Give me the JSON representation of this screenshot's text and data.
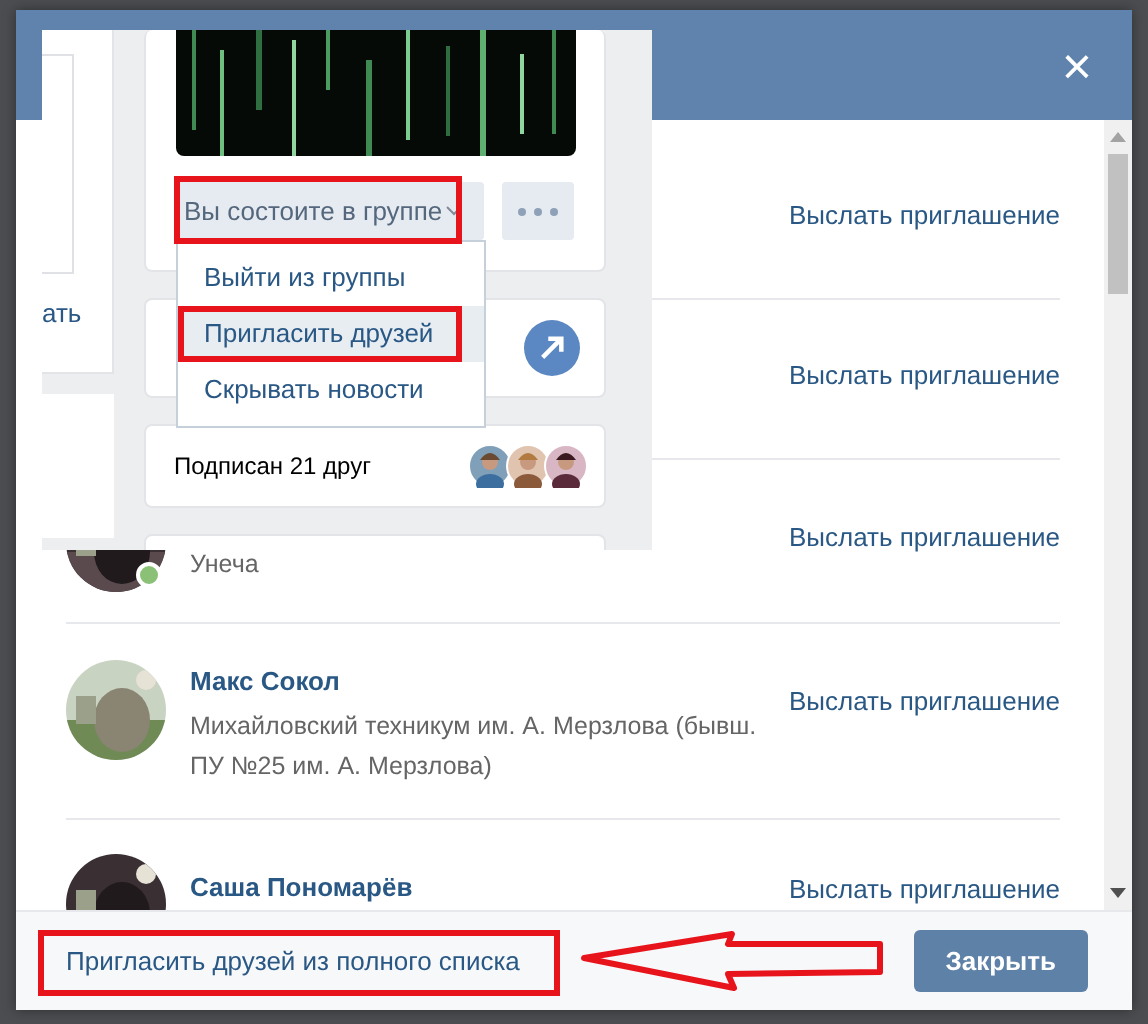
{
  "dialog": {
    "close_icon": "×"
  },
  "friends": [
    {
      "invite": "Выслать приглашение"
    },
    {
      "invite": "Выслать приглашение"
    },
    {
      "subtitle": "Унеча",
      "online": true,
      "invite": "Выслать приглашение"
    },
    {
      "name": "Макс Сокол",
      "subtitle": "Михайловский техникум им. А. Мерзлова (бывш. ПУ №25 им. А. Мерзлова)",
      "online": false,
      "invite": "Выслать приглашение"
    },
    {
      "name": "Саша Пономарёв",
      "online": false,
      "invite": "Выслать приглашение"
    }
  ],
  "footer": {
    "full_list_link": "Пригласить друзей из полного списка",
    "close_button": "Закрыть"
  },
  "inset": {
    "side_text": "ать",
    "member_button": "Вы состоите в группе",
    "menu": [
      {
        "label": "Выйти из группы",
        "selected": false
      },
      {
        "label": "Пригласить друзей",
        "selected": true
      },
      {
        "label": "Скрывать новости",
        "selected": false
      }
    ],
    "subscribed": "Подписан 21 друг"
  }
}
